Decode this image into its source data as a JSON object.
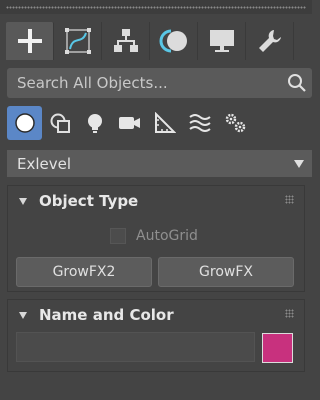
{
  "tabs": [
    {
      "name": "create",
      "icon": "plus-icon",
      "active": true
    },
    {
      "name": "modify",
      "icon": "curve-modify-icon",
      "active": false
    },
    {
      "name": "hierarchy",
      "icon": "hierarchy-icon",
      "active": false
    },
    {
      "name": "motion",
      "icon": "motion-icon",
      "active": false
    },
    {
      "name": "display",
      "icon": "monitor-icon",
      "active": false
    },
    {
      "name": "utilities",
      "icon": "wrench-icon",
      "active": false
    }
  ],
  "search": {
    "placeholder": "Search All Objects..."
  },
  "categories": [
    {
      "icon": "sphere-icon",
      "active": true
    },
    {
      "icon": "shapes-icon",
      "active": false
    },
    {
      "icon": "lightbulb-icon",
      "active": false
    },
    {
      "icon": "camera-icon",
      "active": false
    },
    {
      "icon": "ruler-triangle-icon",
      "active": false
    },
    {
      "icon": "spacewarp-icon",
      "active": false
    },
    {
      "icon": "gears-icon",
      "active": false
    }
  ],
  "dropdown": {
    "value": "Exlevel"
  },
  "object_type": {
    "title": "Object Type",
    "autogrid_label": "AutoGrid",
    "buttons": [
      "GrowFX2",
      "GrowFX"
    ]
  },
  "name_color": {
    "title": "Name and Color",
    "name_value": "",
    "color": "#c8317e"
  },
  "colors": {
    "accent": "#5b87c7",
    "swatch": "#c8317e"
  }
}
